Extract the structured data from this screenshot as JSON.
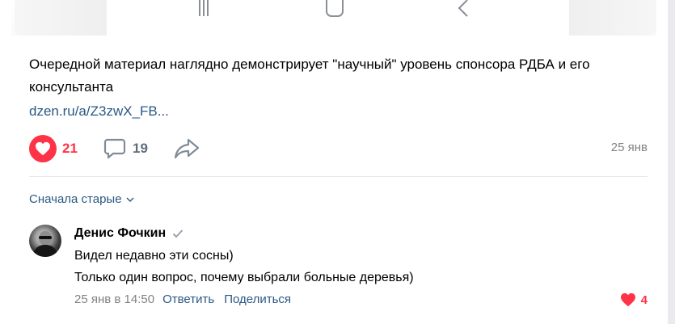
{
  "post": {
    "text": "Очередной материал наглядно демонстрирует \"научный\" уровень спонсора РДБА и его консультанта",
    "link_text": "dzen.ru/a/Z3zwX_FB...",
    "likes": "21",
    "comments": "19",
    "date": "25 янв"
  },
  "comments_section": {
    "sort_label": "Сначала старые",
    "items": [
      {
        "author": "Денис Фочкин",
        "line1": "Видел недавно эти сосны)",
        "line2": "Только один вопрос, почему выбрали больные деревья)",
        "time": "25 янв в 14:50",
        "reply_label": "Ответить",
        "share_label": "Поделиться",
        "likes": "4"
      }
    ]
  },
  "colors": {
    "like": "#ff3347",
    "link": "#2a5885",
    "muted": "#828282",
    "icon": "#818c99"
  }
}
